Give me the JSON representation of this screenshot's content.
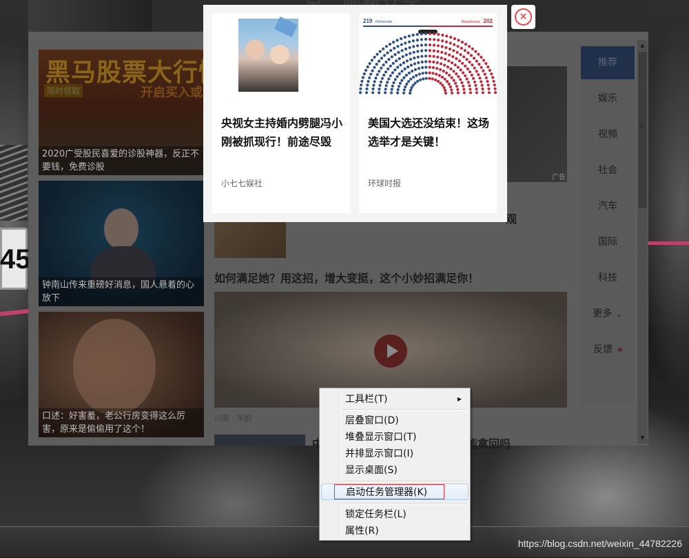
{
  "feed": {
    "left_cards": [
      {
        "banner": "黑马股票大行情",
        "tag1": "限时领取",
        "tag2": "开启买入或",
        "caption": "2020广受股民喜爱的诊股神器，反正不要钱，免费诊股"
      },
      {
        "caption": "钟南山传来重磅好消息，国人悬着的心放下"
      },
      {
        "caption": "口述：好害羞，老公行房变得这么厉害，原来是偷偷用了这个！"
      }
    ],
    "top_title": "另，阿数文字…",
    "image_badge": "广告",
    "row1_title_tail": "观",
    "row2_title": "如何满足她？用这招，增大变挺，这个小妙招满足你！",
    "video_source": "川聚 · 禾韵",
    "row3_title": "中…………………………花的钱能拿回吗"
  },
  "nav": {
    "items": [
      "推荐",
      "娱乐",
      "视频",
      "社会",
      "汽车",
      "国际",
      "科技",
      "更多",
      "反馈"
    ],
    "active_index": 0,
    "more_chevron": "⌄"
  },
  "popup": {
    "cards": [
      {
        "title": "央视女主持婚内劈腿冯小刚被抓现行！前途尽毁",
        "source": "小七七娱社"
      },
      {
        "title": "美国大选还没结束！这场选举才是关键！",
        "source": "环球时报",
        "chart": {
          "left_count": "219",
          "left_label": "Democrats",
          "right_count": "202",
          "right_label": "Republicans",
          "left_color": "#2d4f86",
          "right_color": "#c1283a"
        }
      }
    ],
    "close_icon": "⊗"
  },
  "context_menu": {
    "items": [
      {
        "label": "工具栏(T)",
        "submenu": true
      },
      {
        "label": "层叠窗口(D)"
      },
      {
        "label": "堆叠显示窗口(T)"
      },
      {
        "label": "并排显示窗口(I)"
      },
      {
        "label": "显示桌面(S)"
      },
      {
        "label": "启动任务管理器(K)",
        "highlighted": true
      },
      {
        "label": "锁定任务栏(L)"
      },
      {
        "label": "属性(R)"
      }
    ]
  },
  "watermark": "https://blog.csdn.net/weixin_44782226"
}
